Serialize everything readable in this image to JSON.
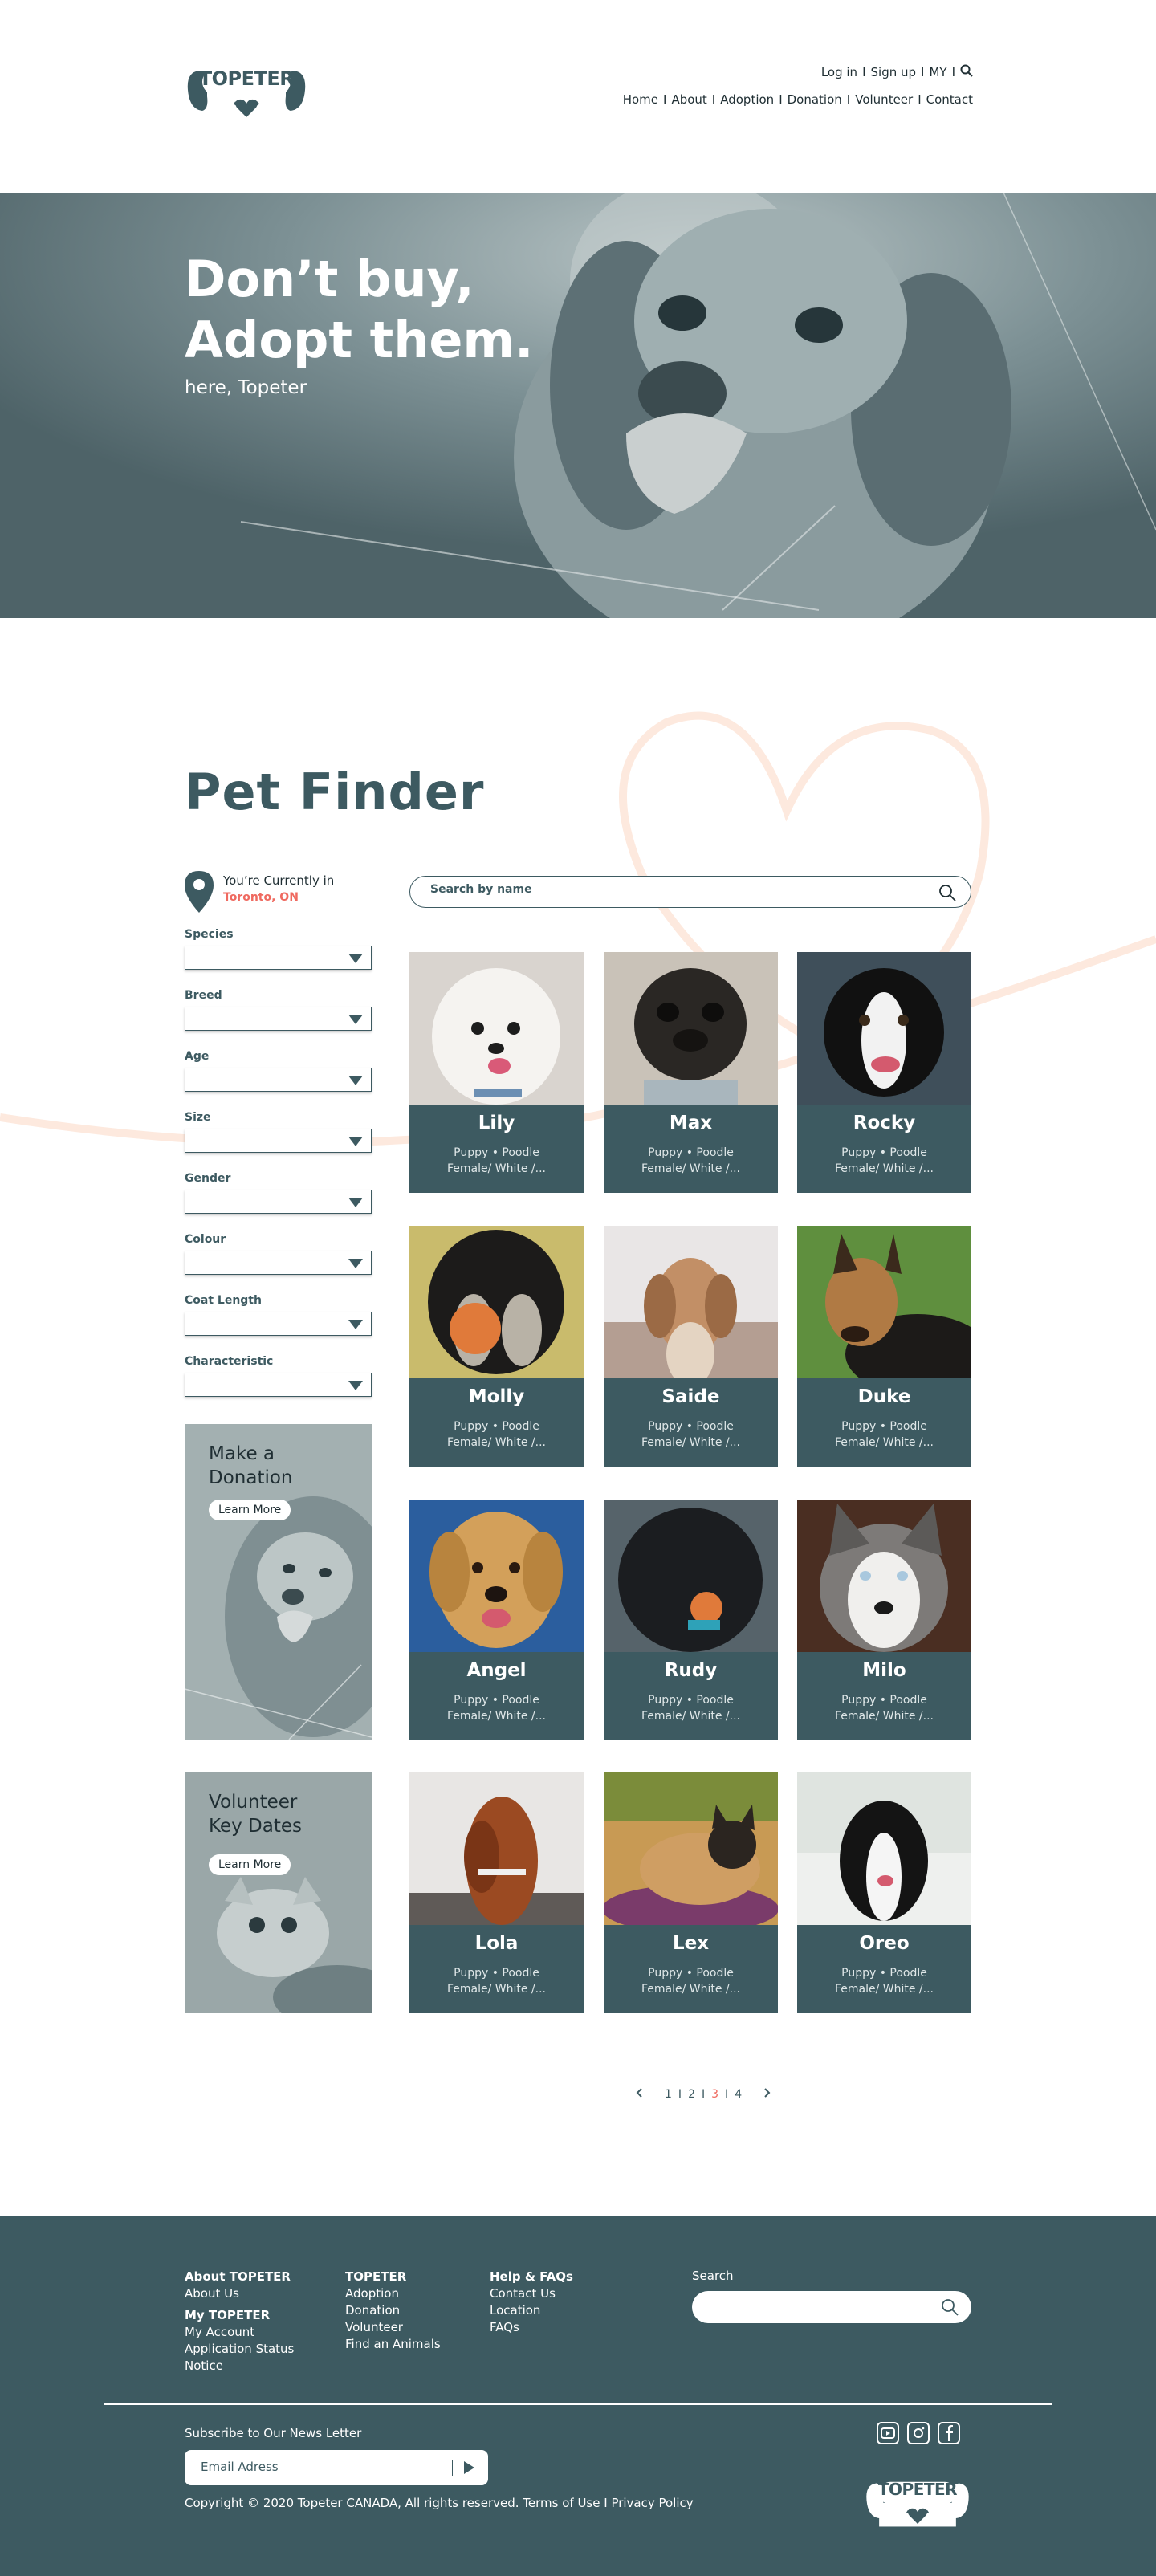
{
  "brand": {
    "logo_text": "TOPETER",
    "primary_color": "#3d5a61",
    "accent_color": "#ef6a60"
  },
  "header": {
    "top_links": [
      "Log in",
      "Sign up",
      "MY"
    ],
    "nav": [
      "Home",
      "About",
      "Adoption",
      "Donation",
      "Volunteer",
      "Contact"
    ]
  },
  "hero": {
    "line1": "Don’t buy,",
    "line2": "Adopt them.",
    "subtitle": "here, Topeter"
  },
  "finder": {
    "title": "Pet Finder",
    "location_label": "You’re Currently in",
    "location_value": "Toronto, ON",
    "search_placeholder": "Search by name",
    "filters": [
      "Species",
      "Breed",
      "Age",
      "Size",
      "Gender",
      "Colour",
      "Coat Length",
      "Characteristic"
    ],
    "promos": [
      {
        "title_line1": "Make a",
        "title_line2": "Donation",
        "button": "Learn More"
      },
      {
        "title_line1": "Volunteer",
        "title_line2": "Key Dates",
        "button": "Learn More"
      }
    ],
    "pets": [
      {
        "name": "Lily",
        "meta1": "Puppy • Poodle",
        "meta2": "Female/ White /..."
      },
      {
        "name": "Max",
        "meta1": "Puppy • Poodle",
        "meta2": "Female/ White /..."
      },
      {
        "name": "Rocky",
        "meta1": "Puppy • Poodle",
        "meta2": "Female/ White /..."
      },
      {
        "name": "Molly",
        "meta1": "Puppy • Poodle",
        "meta2": "Female/ White /..."
      },
      {
        "name": "Saide",
        "meta1": "Puppy • Poodle",
        "meta2": "Female/ White /..."
      },
      {
        "name": "Duke",
        "meta1": "Puppy • Poodle",
        "meta2": "Female/ White /..."
      },
      {
        "name": "Angel",
        "meta1": "Puppy • Poodle",
        "meta2": "Female/ White /..."
      },
      {
        "name": "Rudy",
        "meta1": "Puppy • Poodle",
        "meta2": "Female/ White /..."
      },
      {
        "name": "Milo",
        "meta1": "Puppy • Poodle",
        "meta2": "Female/ White /..."
      },
      {
        "name": "Lola",
        "meta1": "Puppy • Poodle",
        "meta2": "Female/ White /..."
      },
      {
        "name": "Lex",
        "meta1": "Puppy • Poodle",
        "meta2": "Female/ White /..."
      },
      {
        "name": "Oreo",
        "meta1": "Puppy • Poodle",
        "meta2": "Female/ White /..."
      }
    ],
    "pagination": {
      "pages": [
        "1",
        "2",
        "3",
        "4"
      ],
      "current": "3"
    }
  },
  "footer": {
    "col1": {
      "heading1": "About TOPETER",
      "item1": "About Us",
      "heading2": "My TOPETER",
      "items": [
        "My Account",
        "Application Status",
        "Notice"
      ]
    },
    "col2": {
      "heading": "TOPETER",
      "items": [
        "Adoption",
        "Donation",
        "Volunteer",
        "Find an Animals"
      ]
    },
    "col3": {
      "heading": "Help & FAQs",
      "items": [
        "Contact Us",
        "Location",
        "FAQs"
      ]
    },
    "search_label": "Search",
    "subscribe_label": "Subscribe to Our News Letter",
    "email_placeholder": "Email Adress",
    "copyright": "Copyright © 2020 Topeter CANADA, All rights reserved. Terms of Use I Privacy Policy",
    "social": [
      "youtube-icon",
      "instagram-icon",
      "facebook-icon"
    ]
  }
}
